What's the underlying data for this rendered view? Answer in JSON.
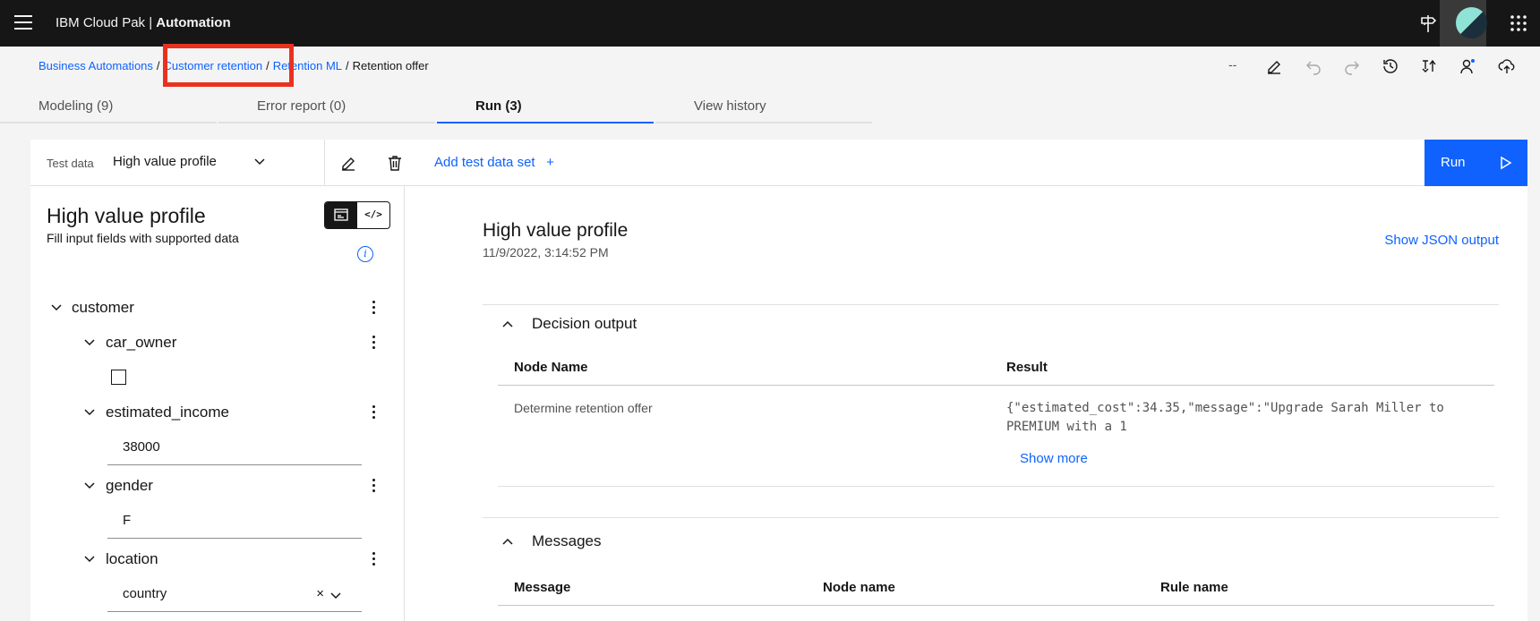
{
  "header": {
    "brand_prefix": "IBM Cloud Pak | ",
    "brand_product": "Automation",
    "icons": [
      "menu-icon",
      "signpost-icon",
      "avatar",
      "app-switcher-icon"
    ]
  },
  "breadcrumb": {
    "items": [
      "Business Automations",
      "Customer retention",
      "Retention ML"
    ],
    "current": "Retention offer",
    "separator": "/"
  },
  "toolbar": {
    "dashes": "--",
    "icons": [
      "edit-icon",
      "undo-icon",
      "redo-icon",
      "history-icon",
      "compare-icon",
      "user-icon",
      "deploy-icon"
    ]
  },
  "tabs": [
    {
      "label": "Modeling (9)",
      "active": false
    },
    {
      "label": "Error report (0)",
      "active": false
    },
    {
      "label": "Run (3)",
      "active": true
    },
    {
      "label": "View history",
      "active": false
    }
  ],
  "test_data_bar": {
    "label": "Test data",
    "selected": "High value profile",
    "add_label": "Add test data set",
    "add_symbol": "+",
    "run_label": "Run"
  },
  "input_panel": {
    "title": "High value profile",
    "subtitle": "Fill input fields with supported data",
    "code_toggle": "</>",
    "info": "i",
    "tree": {
      "root": "customer",
      "fields": {
        "car_owner": {
          "label": "car_owner",
          "checked": false
        },
        "estimated_income": {
          "label": "estimated_income",
          "value": "38000"
        },
        "gender": {
          "label": "gender",
          "value": "F"
        },
        "location": {
          "label": "location",
          "value": "country",
          "clear": "×"
        }
      }
    }
  },
  "output_panel": {
    "title": "High value profile",
    "timestamp": "11/9/2022, 3:14:52 PM",
    "show_json": "Show JSON output",
    "decision": {
      "title": "Decision output",
      "col_node": "Node Name",
      "col_result": "Result",
      "row_node": "Determine retention offer",
      "row_result_line1": "{\"estimated_cost\":34.35,\"message\":\"Upgrade Sarah Miller to",
      "row_result_line2": "PREMIUM with a 1",
      "show_more": "Show more"
    },
    "messages": {
      "title": "Messages",
      "col_message": "Message",
      "col_node": "Node name",
      "col_rule": "Rule name"
    }
  },
  "colors": {
    "accent": "#0f62fe",
    "header_bg": "#161616",
    "highlight": "#e8321f"
  }
}
